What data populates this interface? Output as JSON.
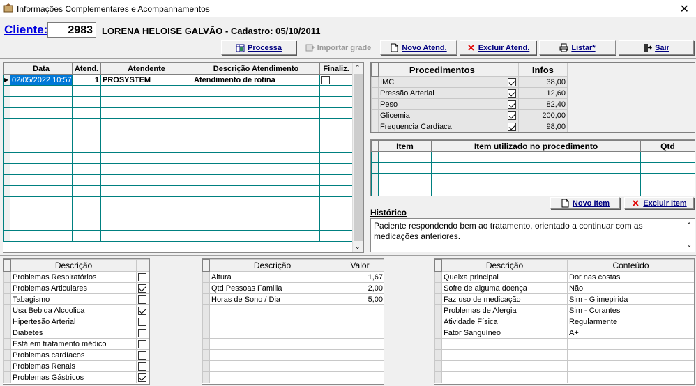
{
  "window": {
    "title": "Informações Complementares e Acompanhamentos",
    "close_glyph": "✕"
  },
  "client": {
    "label": "Cliente:",
    "code": "2983",
    "name": "LORENA HELOISE GALVÃO - Cadastro: 05/10/2011"
  },
  "toolbar": {
    "processa": "Processa",
    "importar": "Importar grade",
    "novo": "Novo Atend.",
    "excluir": "Excluir Atend.",
    "listar": "Listar*",
    "sair": "Sair"
  },
  "atend_table": {
    "headers": [
      "Data",
      "Atend.",
      "Atendente",
      "Descrição Atendimento",
      "Finaliz."
    ],
    "rows": [
      {
        "data": "02/05/2022 10:57",
        "atend": "1",
        "atendente": "PROSYSTEM",
        "descricao": "Atendimento de rotina",
        "finaliz": false
      }
    ]
  },
  "procedimentos": {
    "headers": [
      "Procedimentos",
      "Infos"
    ],
    "rows": [
      {
        "name": "IMC",
        "checked": true,
        "value": "38,00"
      },
      {
        "name": "Pressão Arterial",
        "checked": true,
        "value": "12,60"
      },
      {
        "name": "Peso",
        "checked": true,
        "value": "82,40"
      },
      {
        "name": "Glicemia",
        "checked": true,
        "value": "200,00"
      },
      {
        "name": "Frequencia Cardíaca",
        "checked": true,
        "value": "98,00"
      }
    ]
  },
  "itens": {
    "headers": [
      "Item",
      "Item utilizado no procedimento",
      "Qtd"
    ],
    "novo": "Novo Item",
    "excluir": "Excluir Item"
  },
  "historico": {
    "label": "Histórico",
    "text": "Paciente respondendo bem ao tratamento, orientado a continuar com as medicações anteriores."
  },
  "grid_a": {
    "header": "Descrição",
    "rows": [
      {
        "d": "Problemas Respiratórios",
        "c": false
      },
      {
        "d": "Problemas Articulares",
        "c": true
      },
      {
        "d": "Tabagismo",
        "c": false
      },
      {
        "d": "Usa Bebida Alcoolica",
        "c": true
      },
      {
        "d": "Hipertesão Arterial",
        "c": false
      },
      {
        "d": "Diabetes",
        "c": false
      },
      {
        "d": "Está em tratamento médico",
        "c": false
      },
      {
        "d": "Problemas cardíacos",
        "c": false
      },
      {
        "d": "Problemas Renais",
        "c": false
      },
      {
        "d": "Problemas Gástricos",
        "c": true
      }
    ]
  },
  "grid_b": {
    "headers": [
      "Descrição",
      "Valor"
    ],
    "rows": [
      {
        "d": "Altura",
        "v": "1,67"
      },
      {
        "d": "Qtd Pessoas Familia",
        "v": "2,00"
      },
      {
        "d": "Horas de Sono / Dia",
        "v": "5,00"
      }
    ]
  },
  "grid_c": {
    "headers": [
      "Descrição",
      "Conteúdo"
    ],
    "rows": [
      {
        "d": "Queixa principal",
        "v": "Dor nas costas"
      },
      {
        "d": "Sofre de alguma doença",
        "v": "Não"
      },
      {
        "d": "Faz uso de medicação",
        "v": "Sim - Glimepirida"
      },
      {
        "d": "Problemas de Alergia",
        "v": "Sim - Corantes"
      },
      {
        "d": "Atividade Física",
        "v": "Regularmente"
      },
      {
        "d": "Fator Sanguíneo",
        "v": "A+"
      }
    ]
  }
}
